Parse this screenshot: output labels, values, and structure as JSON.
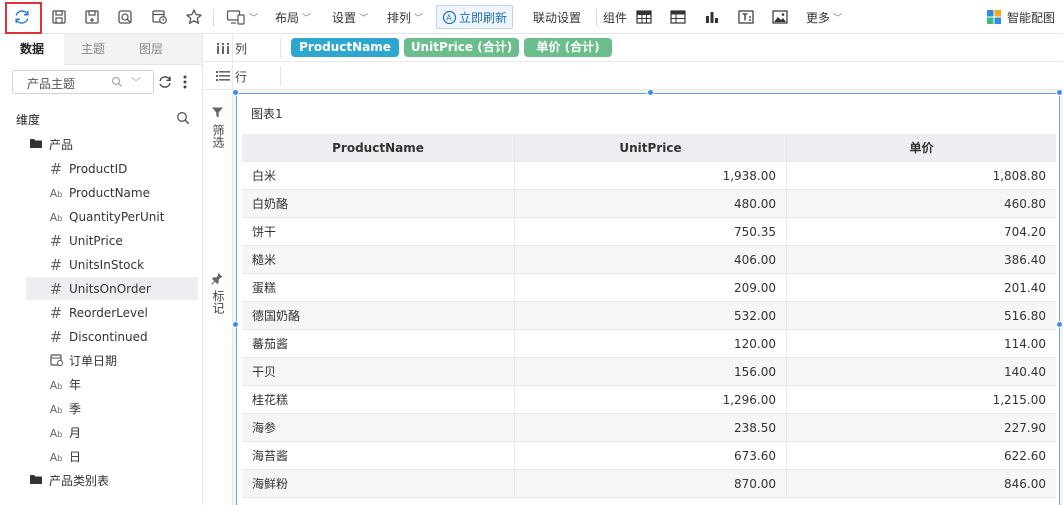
{
  "toolbar": {
    "layout": "布局",
    "settings": "设置",
    "arrange": "排列",
    "refresh_now": "立即刷新",
    "linkage": "联动设置",
    "components": "组件",
    "more": "更多",
    "smart": "智能配图"
  },
  "left": {
    "tabs": [
      "数据",
      "主题",
      "图层"
    ],
    "theme_select": "产品主题",
    "section": "维度",
    "tree": [
      {
        "icon": "folder",
        "label": "产品",
        "level": 0
      },
      {
        "icon": "#",
        "label": "ProductID",
        "level": 1
      },
      {
        "icon": "Ab",
        "label": "ProductName",
        "level": 1
      },
      {
        "icon": "Ab",
        "label": "QuantityPerUnit",
        "level": 1
      },
      {
        "icon": "#",
        "label": "UnitPrice",
        "level": 1
      },
      {
        "icon": "#",
        "label": "UnitsInStock",
        "level": 1
      },
      {
        "icon": "#",
        "label": "UnitsOnOrder",
        "level": 1,
        "selected": true
      },
      {
        "icon": "#",
        "label": "ReorderLevel",
        "level": 1
      },
      {
        "icon": "#",
        "label": "Discontinued",
        "level": 1
      },
      {
        "icon": "date",
        "label": "订单日期",
        "level": 1
      },
      {
        "icon": "Ab",
        "label": "年",
        "level": 1
      },
      {
        "icon": "Ab",
        "label": "季",
        "level": 1
      },
      {
        "icon": "Ab",
        "label": "月",
        "level": 1
      },
      {
        "icon": "Ab",
        "label": "日",
        "level": 1
      },
      {
        "icon": "folder",
        "label": "产品类别表",
        "level": 0
      }
    ]
  },
  "shelf": {
    "columns_label": "列",
    "rows_label": "行",
    "filter_label": "筛选",
    "mark_label": "标记",
    "pills": [
      {
        "label": "ProductName",
        "color": "#2ea7d0"
      },
      {
        "label": "UnitPrice (合计)",
        "color": "#6bbd8c"
      },
      {
        "label": "单价 (合计)",
        "color": "#6bbd8c"
      }
    ]
  },
  "chart": {
    "title": "图表1",
    "headers": [
      "ProductName",
      "UnitPrice",
      "单价"
    ],
    "rows": [
      [
        "白米",
        "1,938.00",
        "1,808.80"
      ],
      [
        "白奶酪",
        "480.00",
        "460.80"
      ],
      [
        "饼干",
        "750.35",
        "704.20"
      ],
      [
        "糙米",
        "406.00",
        "386.40"
      ],
      [
        "蛋糕",
        "209.00",
        "201.40"
      ],
      [
        "德国奶酪",
        "532.00",
        "516.80"
      ],
      [
        "蕃茄酱",
        "120.00",
        "114.00"
      ],
      [
        "干贝",
        "156.00",
        "140.40"
      ],
      [
        "桂花糕",
        "1,296.00",
        "1,215.00"
      ],
      [
        "海参",
        "238.50",
        "227.90"
      ],
      [
        "海苔酱",
        "673.60",
        "622.60"
      ],
      [
        "海鲜粉",
        "870.00",
        "846.00"
      ]
    ]
  }
}
